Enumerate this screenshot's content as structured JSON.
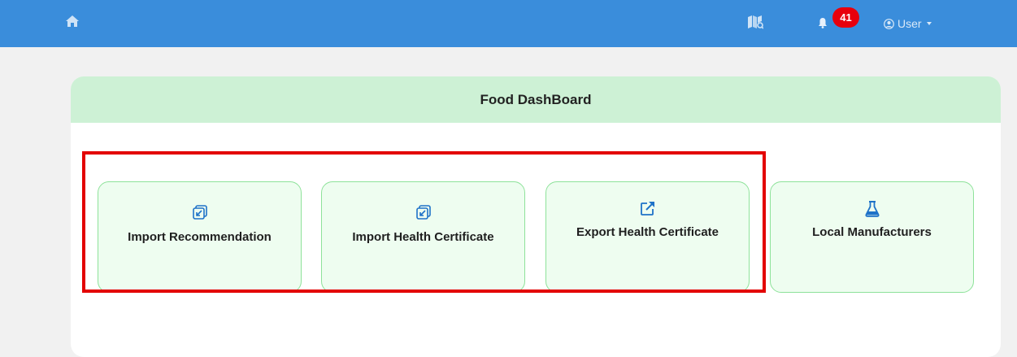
{
  "topbar": {
    "icons": {
      "home": "home-icon",
      "map": "map-icon",
      "bell": "bell-icon"
    },
    "notifications_count": "41",
    "user_label": "User"
  },
  "dashboard": {
    "title": "Food DashBoard",
    "tiles": [
      {
        "label": "Import Recommendation",
        "icon": "import-icon"
      },
      {
        "label": "Import Health Certificate",
        "icon": "import-icon"
      },
      {
        "label": "Export Health Certificate",
        "icon": "external-link-icon"
      },
      {
        "label": "Local Manufacturers",
        "icon": "flask-icon"
      }
    ]
  },
  "colors": {
    "topbar": "#3a8ddb",
    "badge": "#e8000c",
    "header_bg": "#cdf1d5",
    "tile_border": "#8ee29a",
    "tile_bg": "#eefdf0",
    "icon_blue": "#1e72c8",
    "highlight": "#e30000"
  }
}
